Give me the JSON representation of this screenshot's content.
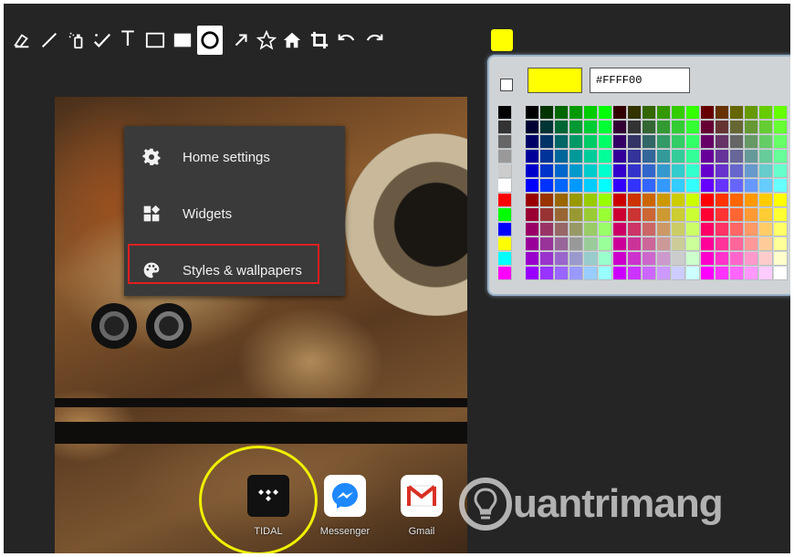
{
  "toolbar": {
    "tools": [
      "eraser",
      "line",
      "spray",
      "checkmark",
      "text",
      "rectangle-outline",
      "rectangle-filled",
      "circle",
      "arrow",
      "star",
      "home",
      "crop",
      "undo",
      "redo"
    ],
    "text_tool_label": "T",
    "active_tool": "circle",
    "current_color": "#FFFF00"
  },
  "phone": {
    "menu": {
      "items": [
        {
          "label": "Home settings",
          "icon": "gear-icon"
        },
        {
          "label": "Widgets",
          "icon": "widgets-icon"
        },
        {
          "label": "Styles & wallpapers",
          "icon": "palette-icon"
        }
      ],
      "highlighted": "Styles & wallpapers",
      "highlight_color": "#e02020"
    },
    "dock": [
      {
        "label": "TIDAL",
        "icon": "tidal-icon"
      },
      {
        "label": "Messenger",
        "icon": "messenger-icon"
      },
      {
        "label": "Gmail",
        "icon": "gmail-icon"
      }
    ],
    "annotation_color": "#f0f000"
  },
  "picker": {
    "hex_value": "#FFFF00",
    "preview_color": "#FFFF00"
  },
  "watermark": {
    "text": "uantrimang"
  }
}
